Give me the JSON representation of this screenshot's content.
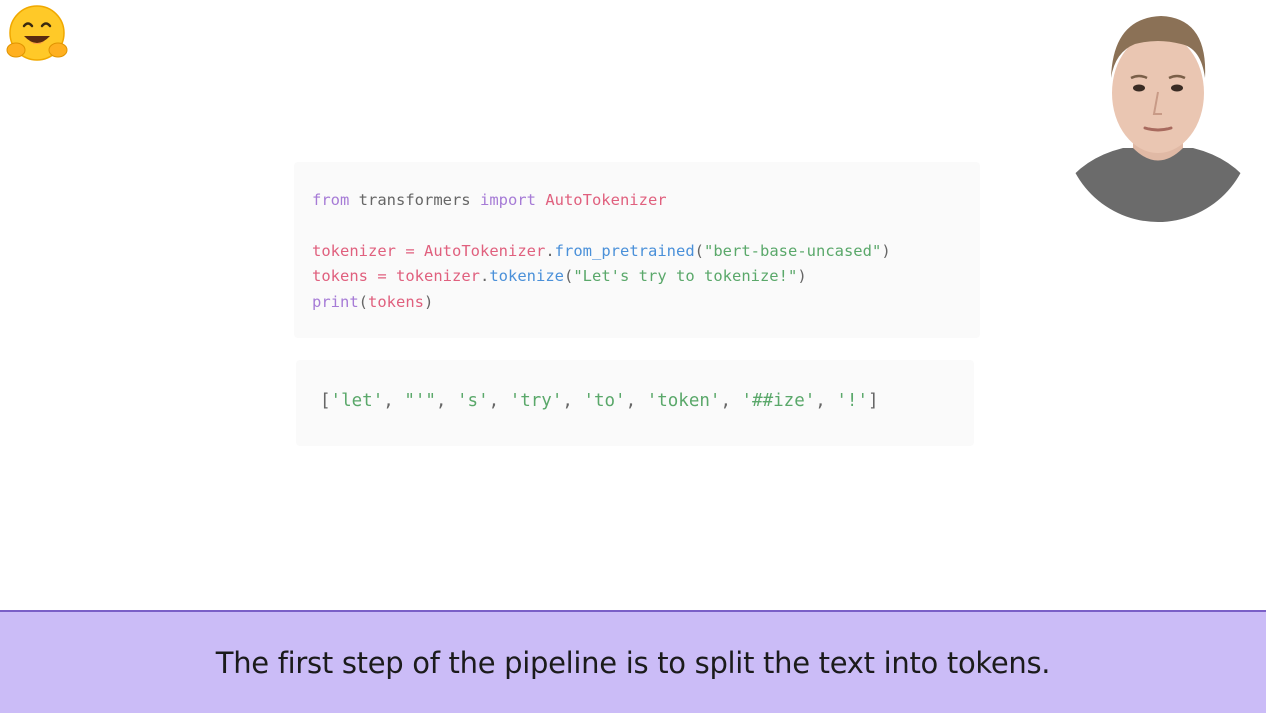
{
  "logo": {
    "icon": "hugging-face-emoji-icon"
  },
  "code": {
    "line1": {
      "kw1": "from",
      "mod": " transformers ",
      "kw2": "import",
      "cls": " AutoTokenizer"
    },
    "line2": {
      "var": "tokenizer",
      "op": " = ",
      "cls": "AutoTokenizer",
      "dot": ".",
      "fn": "from_pretrained",
      "open": "(",
      "arg": "\"bert-base-uncased\"",
      "close": ")"
    },
    "line3": {
      "var": "tokens",
      "op": " = ",
      "obj": "tokenizer",
      "dot": ".",
      "fn": "tokenize",
      "open": "(",
      "arg": "\"Let's try to tokenize!\"",
      "close": ")"
    },
    "line4": {
      "fn": "print",
      "open": "(",
      "arg": "tokens",
      "close": ")"
    }
  },
  "output": {
    "open": "[",
    "tokens": [
      "'let'",
      "\"'\"",
      "'s'",
      "'try'",
      "'to'",
      "'token'",
      "'##ize'",
      "'!'"
    ],
    "close": "]"
  },
  "presenter": {
    "icon": "presenter-video-icon"
  },
  "caption": {
    "text": "The first step of the pipeline is to split the text into tokens."
  },
  "colors": {
    "caption_bg": "#cbbcf7",
    "caption_border": "#7a5fc7",
    "keyword": "#a67bd6",
    "variable": "#e0607e",
    "function": "#4a90d9",
    "string": "#5aa86a"
  }
}
